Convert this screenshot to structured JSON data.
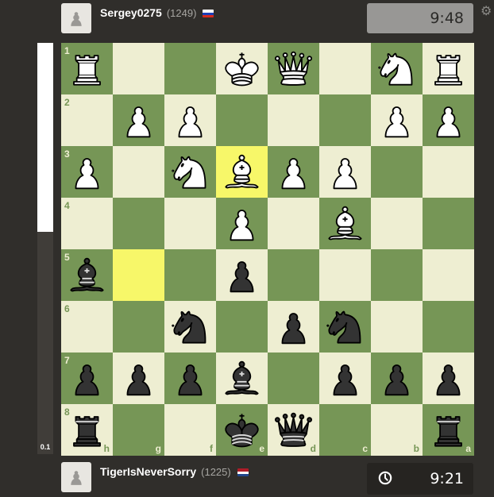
{
  "top_player": {
    "name": "Sergey0275",
    "rating": "(1249)",
    "flag": "ru",
    "clock": "9:48"
  },
  "bottom_player": {
    "name": "TigerIsNeverSorry",
    "rating": "(1225)",
    "flag": "nl",
    "clock": "9:21"
  },
  "eval": {
    "score": "0.1",
    "white_fraction": 0.46
  },
  "board": {
    "orientation": "black",
    "ranks": [
      "1",
      "2",
      "3",
      "4",
      "5",
      "6",
      "7",
      "8"
    ],
    "files": [
      "h",
      "g",
      "f",
      "e",
      "d",
      "c",
      "b",
      "a"
    ],
    "highlights": [
      "e3",
      "g5"
    ],
    "rows": [
      [
        "wR",
        "",
        "",
        "wK",
        "wQ",
        "",
        "wN",
        "wR"
      ],
      [
        "",
        "wP",
        "wP",
        "",
        "",
        "",
        "wP",
        "wP"
      ],
      [
        "wP",
        "",
        "wN",
        "wB",
        "wP",
        "wP",
        "",
        ""
      ],
      [
        "",
        "",
        "",
        "wP",
        "",
        "wB",
        "",
        ""
      ],
      [
        "bB",
        "",
        "",
        "bP",
        "",
        "",
        "",
        ""
      ],
      [
        "",
        "",
        "bN",
        "",
        "bP",
        "bN",
        "",
        ""
      ],
      [
        "bP",
        "bP",
        "bP",
        "bB",
        "",
        "bP",
        "bP",
        "bP"
      ],
      [
        "bR",
        "",
        "",
        "bK",
        "bQ",
        "",
        "",
        "bR"
      ]
    ]
  },
  "icons": {
    "settings": "gear-icon",
    "clock": "clock-icon",
    "avatar": "pawn-avatar-icon"
  }
}
